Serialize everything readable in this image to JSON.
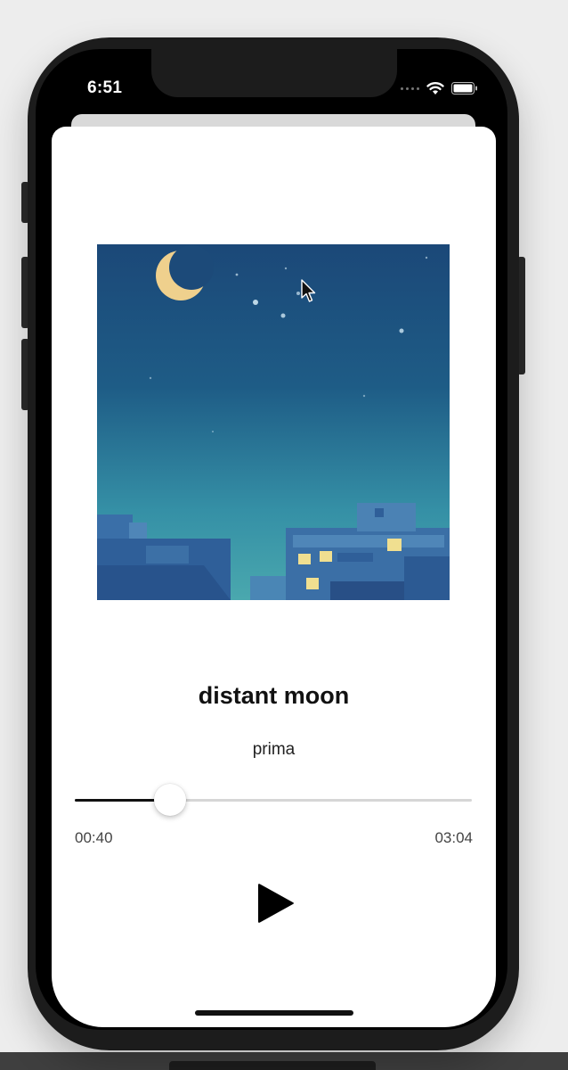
{
  "status_bar": {
    "time": "6:51",
    "icons": [
      "signal-dots-icon",
      "wifi-icon",
      "battery-icon"
    ]
  },
  "player": {
    "title": "distant moon",
    "artist": "prima",
    "elapsed": "00:40",
    "duration": "03:04",
    "progress": 0.24,
    "artwork_icon": "album-art-night-sky-moon",
    "play_icon": "play-icon"
  },
  "colors": {
    "accent": "#111111",
    "track": "#d6d6d6",
    "sheet": "#ffffff",
    "sky_top": "#1b4f7a",
    "sky_bottom": "#3f9fae",
    "moon": "#efd08d"
  }
}
